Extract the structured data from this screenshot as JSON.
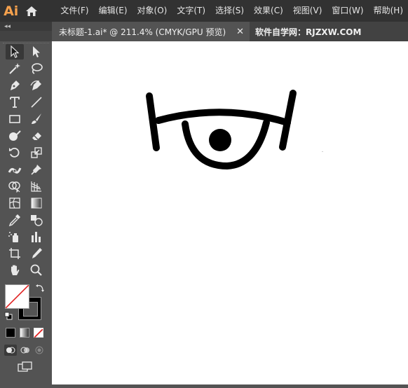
{
  "app": {
    "logo_text": "Ai"
  },
  "menu": {
    "items": [
      "文件(F)",
      "编辑(E)",
      "对象(O)",
      "文字(T)",
      "选择(S)",
      "效果(C)",
      "视图(V)",
      "窗口(W)",
      "帮助(H)"
    ]
  },
  "panel": {
    "collapse_label": "◂◂"
  },
  "tabs": {
    "active_title": "未标题-1.ai* @ 211.4% (CMYK/GPU 预览)",
    "close_glyph": "✕",
    "other_title": "软件自学网：RJZXW.COM"
  },
  "colors": {
    "menubar": "#323232",
    "panel": "#535353",
    "canvas": "#ffffff",
    "brand_orange": "#f6a14d",
    "artwork_stroke": "#000000",
    "none_slash": "#e02020"
  },
  "tools": [
    "selection-tool",
    "direct-selection-tool",
    "magic-wand-tool",
    "lasso-tool",
    "pen-tool",
    "curvature-tool",
    "type-tool",
    "line-segment-tool",
    "rectangle-tool",
    "paintbrush-tool",
    "shaper-tool",
    "eraser-tool",
    "rotate-tool",
    "scale-tool",
    "width-tool",
    "puppet-warp-tool",
    "shape-builder-tool",
    "perspective-grid-tool",
    "mesh-tool",
    "gradient-tool",
    "eyedropper-tool",
    "blend-tool",
    "symbol-sprayer-tool",
    "column-graph-tool",
    "artboard-tool",
    "slice-tool",
    "hand-tool",
    "zoom-tool"
  ]
}
